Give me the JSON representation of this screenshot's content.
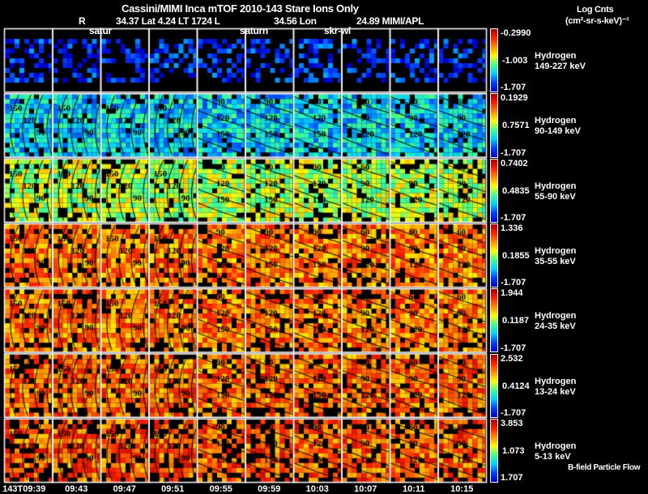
{
  "header": {
    "title": "Cassini/MIMI Inca mTOF  2010-143   Stare   Ions Only",
    "r_label": "R",
    "position_1": "34.37 Lat 4.24 LT 1724 L",
    "position_2": "34.56 Lon",
    "position_3": "24.89  MIMI/APL",
    "units_title": "Log Cnts",
    "units": "(cm²-sr-s-keV)⁻¹"
  },
  "overlay_labels": [
    "satur",
    "saturn",
    "skr-wl"
  ],
  "footer": {
    "legend_note": "B-field Particle Flow"
  },
  "chart_data": {
    "type": "heatmap",
    "title": "Cassini/MIMI Inca mTOF 2010-143 Stare Ions Only",
    "x_tick_labels": [
      "143T09:39",
      "09:43",
      "09:47",
      "09:51",
      "09:55",
      "09:59",
      "10:03",
      "10:07",
      "10:11",
      "10:15"
    ],
    "contour_labels": [
      "60",
      "90",
      "120",
      "150"
    ],
    "rows": [
      {
        "species": "Hydrogen",
        "energy": "149-227 keV",
        "max": "-0.2990",
        "mid": "-1.003",
        "min": "-1.707",
        "level": 0.1
      },
      {
        "species": "Hydrogen",
        "energy": "90-149 keV",
        "max": "0.1929",
        "mid": "0.7571",
        "min": "-1.707",
        "level": 0.3
      },
      {
        "species": "Hydrogen",
        "energy": "55-90 keV",
        "max": "0.7402",
        "mid": "0.4835",
        "min": "-1.707",
        "level": 0.52
      },
      {
        "species": "Hydrogen",
        "energy": "35-55 keV",
        "max": "1.336",
        "mid": "0.1855",
        "min": "-1.707",
        "level": 0.74
      },
      {
        "species": "Hydrogen",
        "energy": "24-35 keV",
        "max": "1.944",
        "mid": "0.1187",
        "min": "-1.707",
        "level": 0.74
      },
      {
        "species": "Hydrogen",
        "energy": "13-24 keV",
        "max": "2.532",
        "mid": "0.4124",
        "min": "-1.707",
        "level": 0.76
      },
      {
        "species": "Hydrogen",
        "energy": "5-13 keV",
        "max": "3.853",
        "mid": "1.073",
        "min": "1.707",
        "level": 0.78
      }
    ],
    "colormap": [
      "#0000c8",
      "#00d0ff",
      "#40ff90",
      "#ffff00",
      "#ff9000",
      "#ff2000",
      "#a00000"
    ]
  }
}
